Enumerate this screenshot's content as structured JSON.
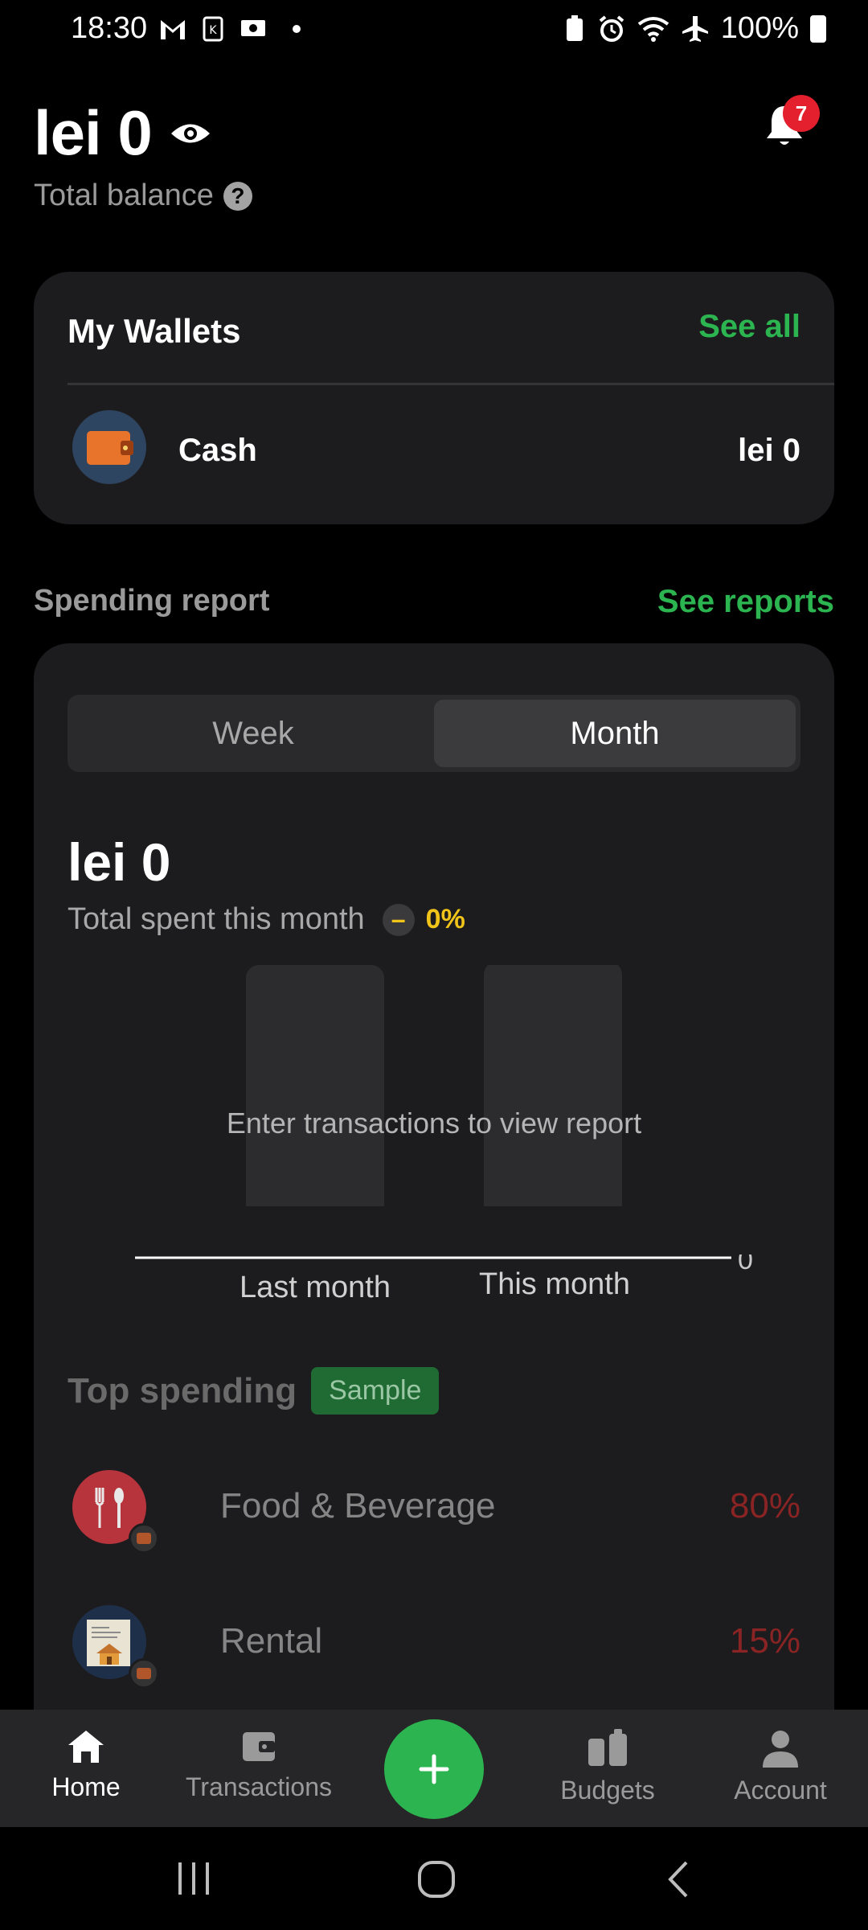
{
  "status_bar": {
    "time": "18:30",
    "battery": "100%"
  },
  "header": {
    "balance": "lei 0",
    "balance_label": "Total balance",
    "help_glyph": "?",
    "notifications_count": "7"
  },
  "wallets": {
    "title": "My Wallets",
    "see_all": "See all",
    "items": [
      {
        "name": "Cash",
        "amount": "lei 0",
        "icon": "wallet-icon"
      }
    ]
  },
  "spending_report": {
    "title": "Spending report",
    "see_reports": "See reports",
    "tabs": [
      {
        "label": "Week",
        "selected": false
      },
      {
        "label": "Month",
        "selected": true
      }
    ],
    "total": "lei 0",
    "total_label": "Total spent this month",
    "change_glyph": "–",
    "change_pct": "0%",
    "chart_data": {
      "type": "bar",
      "categories": [
        "Last month",
        "This month"
      ],
      "values": [
        0,
        0
      ],
      "empty_message": "Enter transactions to view report",
      "y_tick_labels": [
        "0"
      ]
    },
    "top_spending": {
      "title": "Top spending",
      "badge": "Sample",
      "items": [
        {
          "name": "Food & Beverage",
          "percent": "80%",
          "icon": "fork-spoon-icon",
          "color": "#c0343d"
        },
        {
          "name": "Rental",
          "percent": "15%",
          "icon": "house-document-icon",
          "color": "#1e2f4a"
        }
      ]
    }
  },
  "bottom_nav": {
    "items": [
      {
        "label": "Home",
        "icon": "home-icon",
        "active": true
      },
      {
        "label": "Transactions",
        "icon": "wallet-icon",
        "active": false
      },
      {
        "label": "Budgets",
        "icon": "budgets-icon",
        "active": false
      },
      {
        "label": "Account",
        "icon": "person-icon",
        "active": false
      }
    ],
    "fab_glyph": "+"
  },
  "colors": {
    "accent": "#2bb450",
    "warning": "#f0c419",
    "badge": "#e4202e",
    "danger_text": "#8a2424"
  }
}
